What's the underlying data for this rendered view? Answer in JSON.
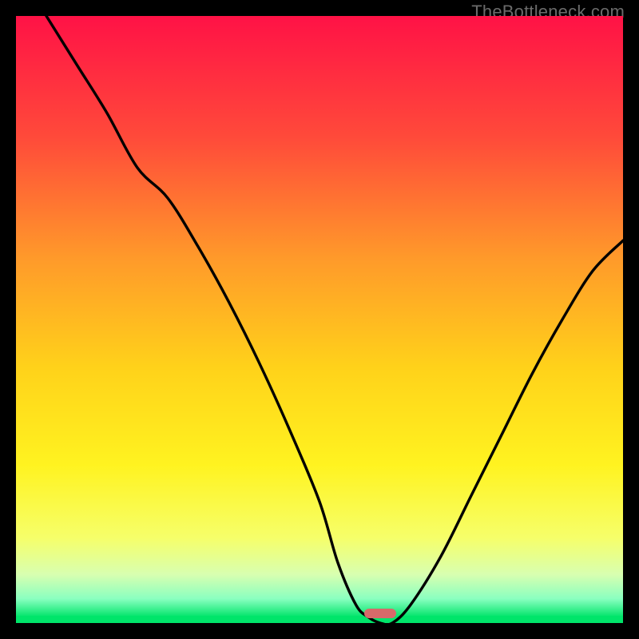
{
  "attribution": "TheBottleneck.com",
  "gradient_stops": [
    {
      "offset": 0.0,
      "color": "#ff1246"
    },
    {
      "offset": 0.2,
      "color": "#ff4a3a"
    },
    {
      "offset": 0.4,
      "color": "#ff9a2a"
    },
    {
      "offset": 0.58,
      "color": "#ffd21a"
    },
    {
      "offset": 0.74,
      "color": "#fff320"
    },
    {
      "offset": 0.86,
      "color": "#f6ff6a"
    },
    {
      "offset": 0.92,
      "color": "#d8ffb0"
    },
    {
      "offset": 0.96,
      "color": "#8affc0"
    },
    {
      "offset": 0.99,
      "color": "#00e56a"
    },
    {
      "offset": 1.0,
      "color": "#00d85e"
    }
  ],
  "chart_data": {
    "type": "line",
    "title": "",
    "xlabel": "",
    "ylabel": "",
    "xlim": [
      0,
      100
    ],
    "ylim": [
      0,
      100
    ],
    "grid": false,
    "legend": false,
    "series": [
      {
        "name": "curve",
        "x": [
          5,
          10,
          15,
          20,
          25,
          30,
          35,
          40,
          45,
          50,
          53,
          56,
          58,
          60,
          62,
          65,
          70,
          75,
          80,
          85,
          90,
          95,
          100
        ],
        "y": [
          100,
          92,
          84,
          75,
          70,
          62,
          53,
          43,
          32,
          20,
          10,
          3,
          1,
          0,
          0,
          3,
          11,
          21,
          31,
          41,
          50,
          58,
          63
        ]
      }
    ],
    "marker": {
      "x": 60,
      "y": 0,
      "shape": "pill",
      "color": "#d76a6a"
    },
    "bottom_band": {
      "color": "#00e56a",
      "height_fraction": 0.012
    }
  }
}
